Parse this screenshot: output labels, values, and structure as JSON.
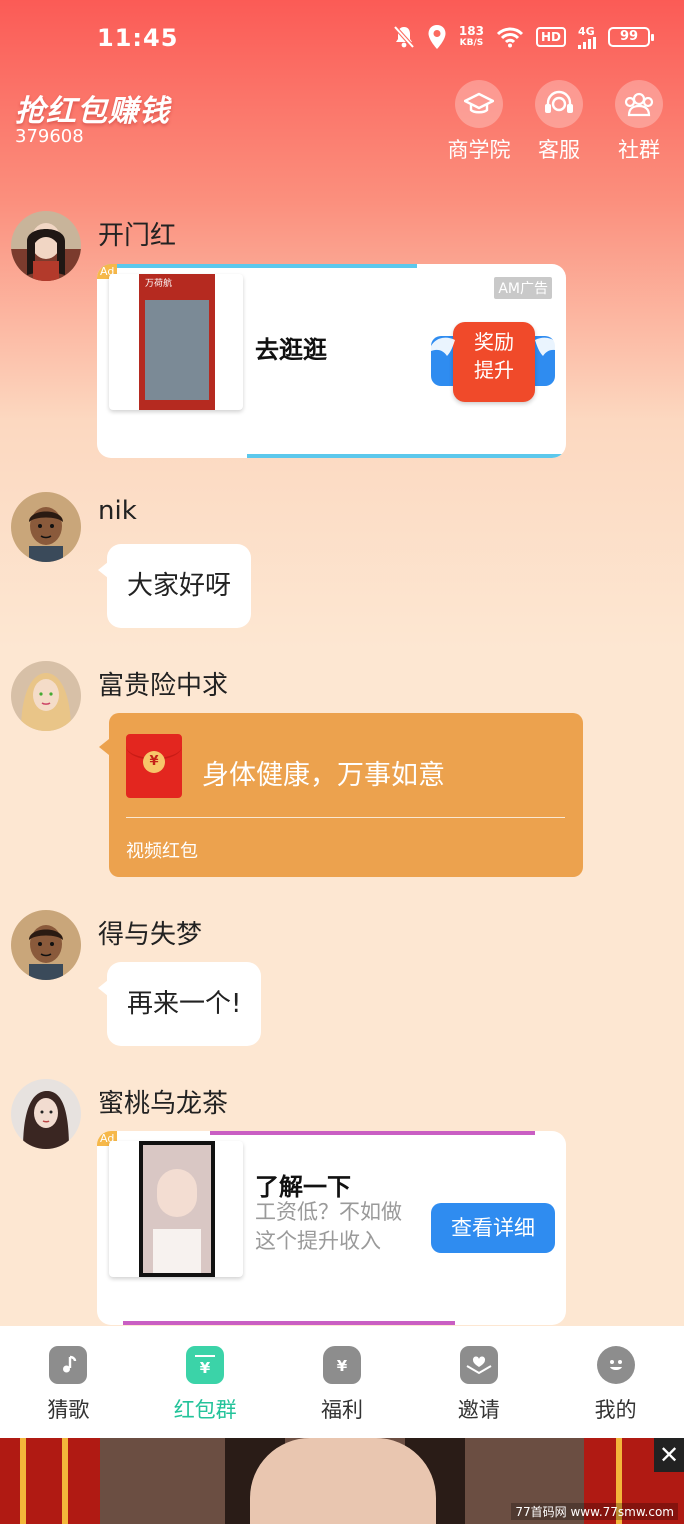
{
  "status_bar": {
    "time": "11:45",
    "net_speed_top": "183",
    "net_speed_unit": "KB/S",
    "hd_label": "HD",
    "signal_label": "4G",
    "battery": "99"
  },
  "header": {
    "title": "抢红包赚钱",
    "group_id": "379608",
    "actions": [
      {
        "label": "商学院",
        "icon": "graduation-cap-icon"
      },
      {
        "label": "客服",
        "icon": "headset-icon"
      },
      {
        "label": "社群",
        "icon": "group-icon"
      }
    ]
  },
  "messages": [
    {
      "sender": "开门红",
      "type": "ad",
      "ad": {
        "tag": "Ad",
        "badge": "AM广告",
        "thumb_title": "万荷航",
        "headline": "去逛逛",
        "reward_label_1": "奖励",
        "reward_label_2": "提升"
      }
    },
    {
      "sender": "nik",
      "type": "text",
      "text": "大家好呀"
    },
    {
      "sender": "富贵险中求",
      "type": "red_packet",
      "packet": {
        "title": "身体健康，万事如意",
        "footer": "视频红包",
        "seal": "¥"
      }
    },
    {
      "sender": "得与失梦",
      "type": "text",
      "text": "再来一个!"
    },
    {
      "sender": "蜜桃乌龙茶",
      "type": "ad",
      "ad": {
        "tag": "Ad",
        "headline": "了解一下",
        "sub_line_1": "工资低？不如做",
        "sub_line_2": "这个提升收入",
        "cta": "查看详细"
      }
    }
  ],
  "tabbar": {
    "tabs": [
      {
        "label": "猜歌",
        "icon": "music-note-icon",
        "active": false
      },
      {
        "label": "红包群",
        "icon": "red-packet-icon",
        "active": true
      },
      {
        "label": "福利",
        "icon": "money-bag-icon",
        "active": false
      },
      {
        "label": "邀请",
        "icon": "envelope-heart-icon",
        "active": false
      },
      {
        "label": "我的",
        "icon": "smile-face-icon",
        "active": false
      }
    ]
  },
  "banner": {
    "close": "✕",
    "watermark": "77首码网 www.77smw.com"
  },
  "colors": {
    "header_red": "#fb5b56",
    "packet_orange": "#eca24e",
    "active_tab": "#23c39a",
    "cta_blue": "#2f8cf0"
  }
}
